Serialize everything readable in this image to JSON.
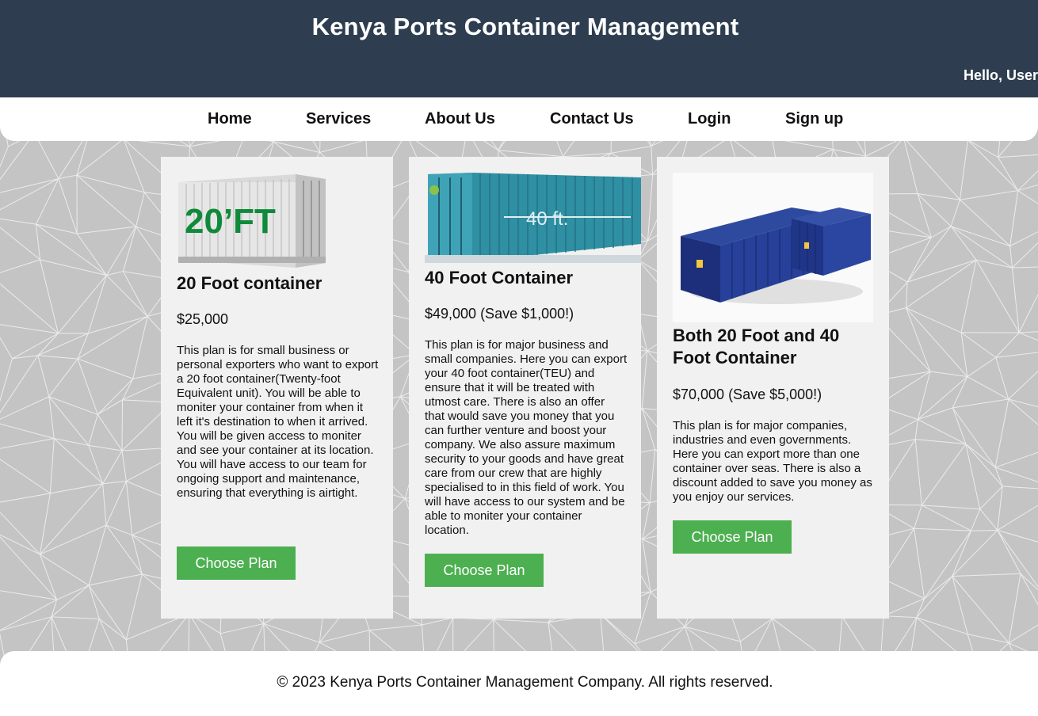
{
  "header": {
    "title": "Kenya Ports Container Management",
    "greeting": "Hello, User"
  },
  "nav": {
    "items": [
      "Home",
      "Services",
      "About Us",
      "Contact Us",
      "Login",
      "Sign up"
    ]
  },
  "plans": [
    {
      "image_label": "20’FT",
      "title": "20 Foot container",
      "price": "$25,000",
      "description": "This plan is for small business or personal exporters who want to export a 20 foot container(Twenty-foot Equivalent unit). You will be able to moniter your container from when it left it's destination to when it arrived. You will be given access to moniter and see your container at its location. You will have access to our team for ongoing support and maintenance, ensuring that everything is airtight.",
      "button": "Choose Plan"
    },
    {
      "image_label": "40 ft.",
      "title": "40 Foot Container",
      "price": "$49,000 (Save $1,000!)",
      "description": "This plan is for major business and small companies. Here you can export your 40 foot container(TEU) and ensure that it will be treated with utmost care. There is also an offer that would save you money that you can further venture and boost your company. We also assure maximum security to your goods and have great care from our crew that are highly specialised to in this field of work. You will have access to our system and be able to moniter your container location.",
      "button": "Choose Plan"
    },
    {
      "title": "Both 20 Foot and 40 Foot Container",
      "price": "$70,000 (Save $5,000!)",
      "description": "This plan is for major companies, industries and even governments. Here you can export more than one container over seas. There is also a discount added to save you money as you enjoy our services.",
      "button": "Choose Plan"
    }
  ],
  "footer": {
    "copyright": "© 2023 Kenya Ports Container Management Company. All rights reserved."
  },
  "colors": {
    "header_bg": "#2e3e50",
    "button_bg": "#4caf50",
    "card_bg": "#f1f1f1",
    "pattern_bg": "#c4c4c4"
  }
}
